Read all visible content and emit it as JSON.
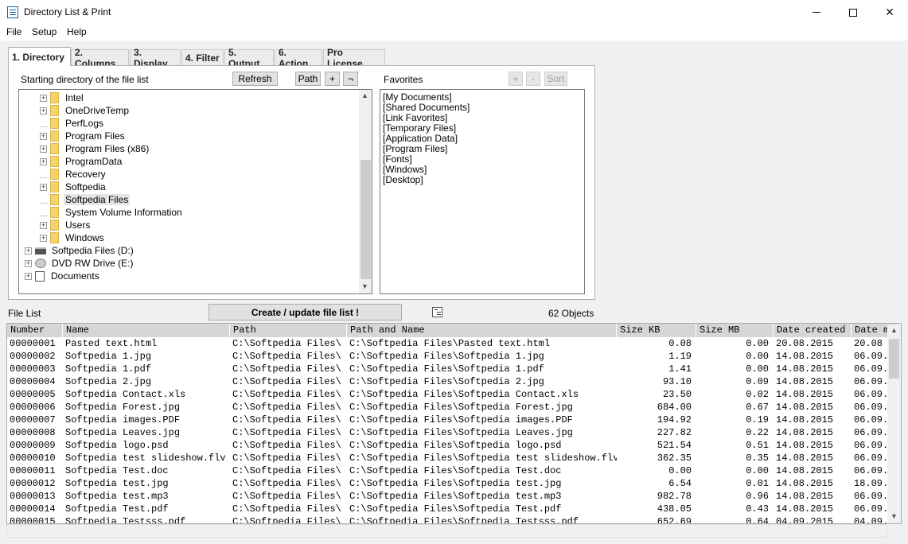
{
  "window": {
    "title": "Directory List & Print",
    "minimize": "—",
    "close": "✕"
  },
  "menu": [
    "File",
    "Setup",
    "Help"
  ],
  "tabs": [
    "1. Directory",
    "2. Columns",
    "3. Display",
    "4. Filter",
    "5. Output",
    "6. Action",
    "Pro License"
  ],
  "directory": {
    "start_label": "Starting directory of the file list",
    "refresh": "Refresh",
    "path": "Path",
    "plus": "+",
    "neg": "¬",
    "tree": [
      {
        "label": "Intel",
        "level": 2,
        "expander": "+",
        "icon": "folder"
      },
      {
        "label": "OneDriveTemp",
        "level": 2,
        "expander": "+",
        "icon": "folder"
      },
      {
        "label": "PerfLogs",
        "level": 2,
        "expander": "",
        "icon": "folder"
      },
      {
        "label": "Program Files",
        "level": 2,
        "expander": "+",
        "icon": "folder"
      },
      {
        "label": "Program Files (x86)",
        "level": 2,
        "expander": "+",
        "icon": "folder"
      },
      {
        "label": "ProgramData",
        "level": 2,
        "expander": "+",
        "icon": "folder"
      },
      {
        "label": "Recovery",
        "level": 2,
        "expander": "",
        "icon": "folder"
      },
      {
        "label": "Softpedia",
        "level": 2,
        "expander": "+",
        "icon": "folder"
      },
      {
        "label": "Softpedia Files",
        "level": 2,
        "expander": "",
        "icon": "folder",
        "selected": true
      },
      {
        "label": "System Volume Information",
        "level": 2,
        "expander": "",
        "icon": "folder"
      },
      {
        "label": "Users",
        "level": 2,
        "expander": "+",
        "icon": "folder"
      },
      {
        "label": "Windows",
        "level": 2,
        "expander": "+",
        "icon": "folder"
      },
      {
        "label": "Softpedia Files (D:)",
        "level": 1,
        "expander": "+",
        "icon": "drive"
      },
      {
        "label": "DVD RW Drive (E:)",
        "level": 1,
        "expander": "+",
        "icon": "dvd"
      },
      {
        "label": "Documents",
        "level": 1,
        "expander": "+",
        "icon": "doc"
      }
    ]
  },
  "favorites": {
    "label": "Favorites",
    "add": "+",
    "remove": "-",
    "sort": "Sort",
    "items": [
      "[My Documents]",
      "[Shared Documents]",
      "[Link Favorites]",
      "[Temporary Files]",
      "[Application Data]",
      "[Program Files]",
      "[Fonts]",
      "[Windows]",
      "[Desktop]"
    ]
  },
  "filelist": {
    "label": "File List",
    "create": "Create / update file list !",
    "count": "62 Objects",
    "columns": [
      "Number",
      "Name",
      "Path",
      "Path and Name",
      "Size KB",
      "Size MB",
      "Date created",
      "Date m"
    ],
    "rows": [
      [
        "00000001",
        "Pasted text.html",
        "C:\\Softpedia Files\\",
        "C:\\Softpedia Files\\Pasted text.html",
        "0.08",
        "0.00",
        "20.08.2015",
        "20.08"
      ],
      [
        "00000002",
        "Softpedia 1.jpg",
        "C:\\Softpedia Files\\",
        "C:\\Softpedia Files\\Softpedia 1.jpg",
        "1.19",
        "0.00",
        "14.08.2015",
        "06.09."
      ],
      [
        "00000003",
        "Softpedia 1.pdf",
        "C:\\Softpedia Files\\",
        "C:\\Softpedia Files\\Softpedia 1.pdf",
        "1.41",
        "0.00",
        "14.08.2015",
        "06.09."
      ],
      [
        "00000004",
        "Softpedia 2.jpg",
        "C:\\Softpedia Files\\",
        "C:\\Softpedia Files\\Softpedia 2.jpg",
        "93.10",
        "0.09",
        "14.08.2015",
        "06.09."
      ],
      [
        "00000005",
        "Softpedia Contact.xls",
        "C:\\Softpedia Files\\",
        "C:\\Softpedia Files\\Softpedia Contact.xls",
        "23.50",
        "0.02",
        "14.08.2015",
        "06.09."
      ],
      [
        "00000006",
        "Softpedia Forest.jpg",
        "C:\\Softpedia Files\\",
        "C:\\Softpedia Files\\Softpedia Forest.jpg",
        "684.00",
        "0.67",
        "14.08.2015",
        "06.09."
      ],
      [
        "00000007",
        "Softpedia images.PDF",
        "C:\\Softpedia Files\\",
        "C:\\Softpedia Files\\Softpedia images.PDF",
        "194.92",
        "0.19",
        "14.08.2015",
        "06.09."
      ],
      [
        "00000008",
        "Softpedia Leaves.jpg",
        "C:\\Softpedia Files\\",
        "C:\\Softpedia Files\\Softpedia Leaves.jpg",
        "227.82",
        "0.22",
        "14.08.2015",
        "06.09."
      ],
      [
        "00000009",
        "Softpedia logo.psd",
        "C:\\Softpedia Files\\",
        "C:\\Softpedia Files\\Softpedia logo.psd",
        "521.54",
        "0.51",
        "14.08.2015",
        "06.09."
      ],
      [
        "00000010",
        "Softpedia test slideshow.flv",
        "C:\\Softpedia Files\\",
        "C:\\Softpedia Files\\Softpedia test slideshow.flv",
        "362.35",
        "0.35",
        "14.08.2015",
        "06.09."
      ],
      [
        "00000011",
        "Softpedia Test.doc",
        "C:\\Softpedia Files\\",
        "C:\\Softpedia Files\\Softpedia Test.doc",
        "0.00",
        "0.00",
        "14.08.2015",
        "06.09."
      ],
      [
        "00000012",
        "Softpedia test.jpg",
        "C:\\Softpedia Files\\",
        "C:\\Softpedia Files\\Softpedia test.jpg",
        "6.54",
        "0.01",
        "14.08.2015",
        "18.09."
      ],
      [
        "00000013",
        "Softpedia test.mp3",
        "C:\\Softpedia Files\\",
        "C:\\Softpedia Files\\Softpedia test.mp3",
        "982.78",
        "0.96",
        "14.08.2015",
        "06.09."
      ],
      [
        "00000014",
        "Softpedia Test.pdf",
        "C:\\Softpedia Files\\",
        "C:\\Softpedia Files\\Softpedia Test.pdf",
        "438.05",
        "0.43",
        "14.08.2015",
        "06.09."
      ],
      [
        "00000015",
        "Softpedia Testsss.pdf",
        "C:\\Softpedia Files\\",
        "C:\\Softpedia Files\\Softpedia Testsss.pdf",
        "652.69",
        "0.64",
        "04.09.2015",
        "04.09."
      ]
    ]
  }
}
